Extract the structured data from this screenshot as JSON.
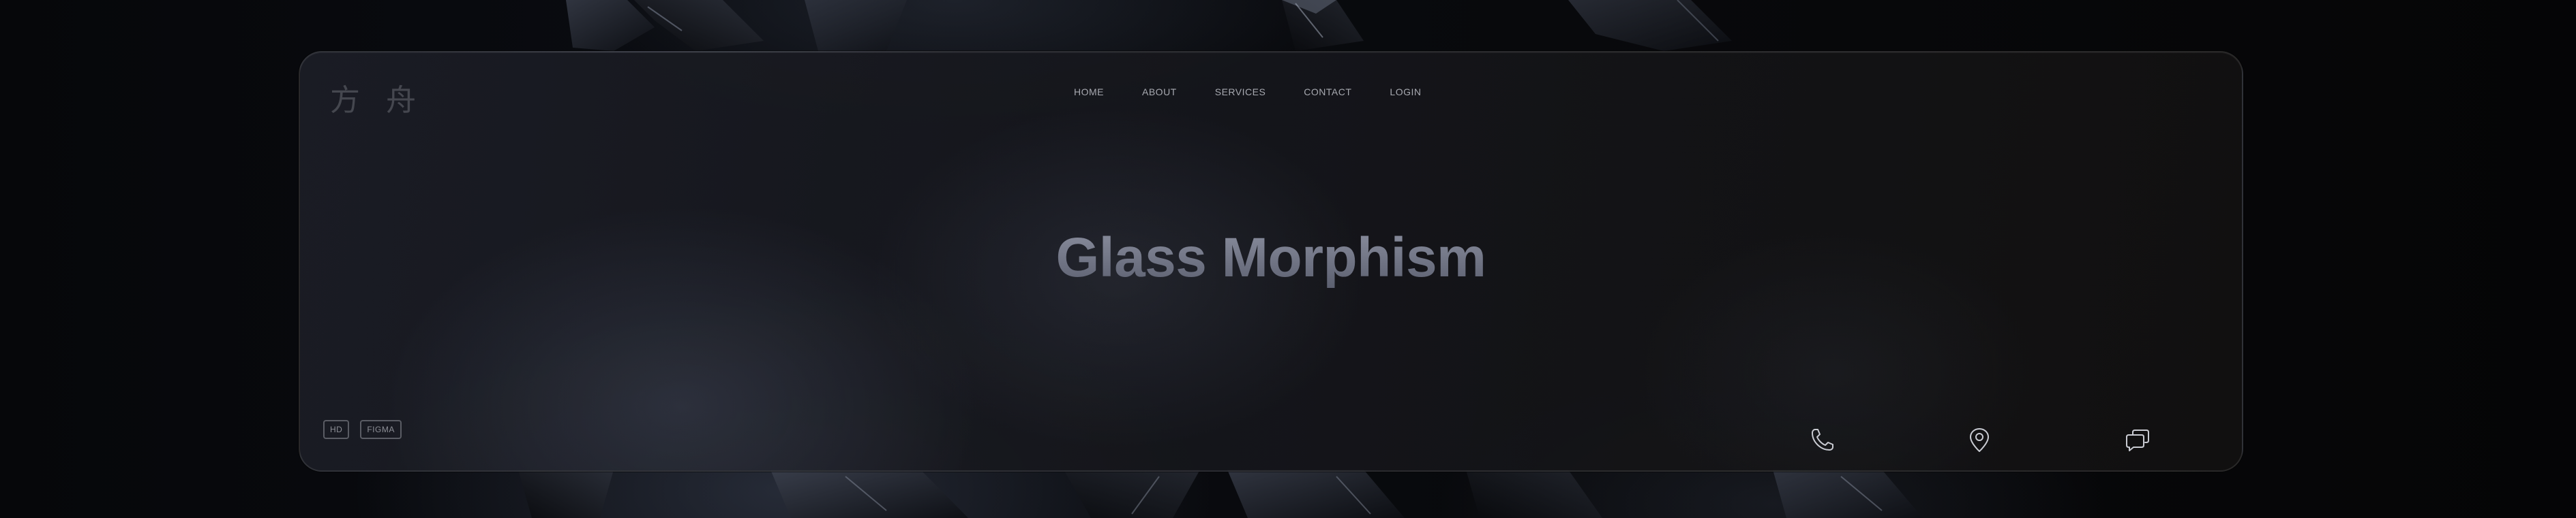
{
  "logo": {
    "text": "方 舟"
  },
  "nav": {
    "items": [
      {
        "label": "HOME"
      },
      {
        "label": "ABOUT"
      },
      {
        "label": "SERVICES"
      },
      {
        "label": "CONTACT"
      },
      {
        "label": "LOGIN"
      }
    ]
  },
  "hero": {
    "title": "Glass Morphism"
  },
  "badges": [
    {
      "label": "HD"
    },
    {
      "label": "FIGMA"
    }
  ],
  "contact_icons": [
    {
      "icon": "phone-icon"
    },
    {
      "icon": "location-pin-icon"
    },
    {
      "icon": "chat-bubbles-icon"
    }
  ],
  "colors": {
    "background": "#07080b",
    "card_border": "#2a2b30",
    "title_gradient_top": "#8c90a0",
    "title_gradient_bottom": "#5a5e6e",
    "nav_text": "#a7a9b0",
    "icon_stroke": "#c9cbd2"
  }
}
